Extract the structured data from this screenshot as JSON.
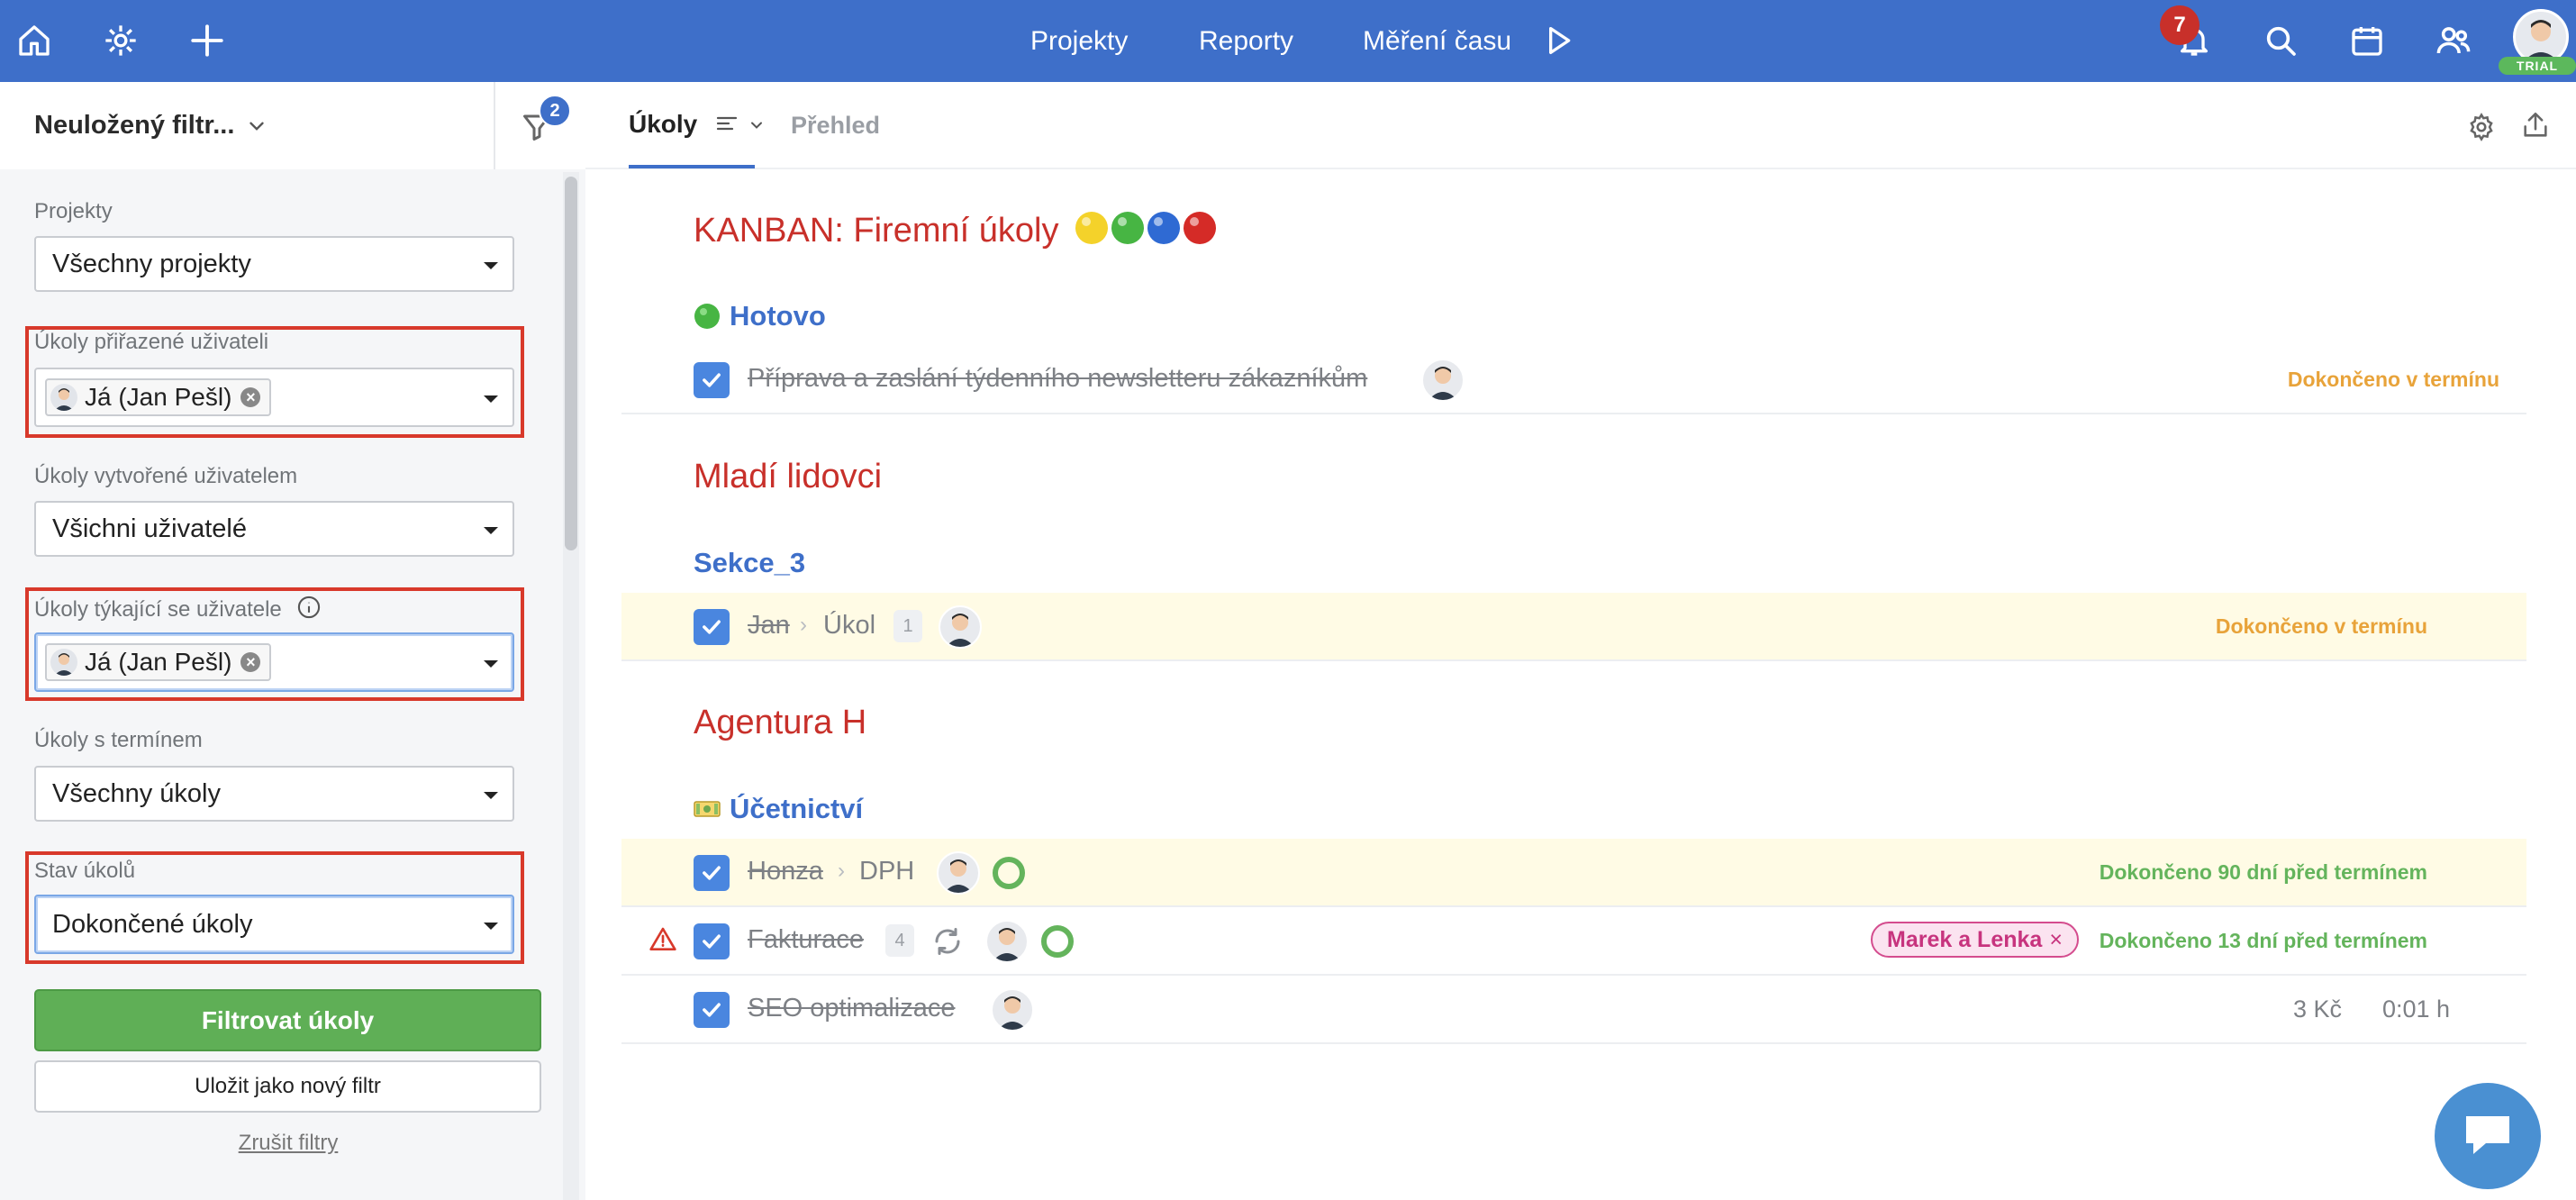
{
  "topbar": {
    "nav": [
      "Projekty",
      "Reporty",
      "Měření času"
    ],
    "notifications_count": "7",
    "trial_label": "TRIAL",
    "icons": [
      "home-icon",
      "settings-icon",
      "plus-icon",
      "play-icon",
      "bell-icon",
      "search-icon",
      "calendar-icon",
      "users-icon"
    ]
  },
  "sidebar": {
    "filter_name": "Neuložený filtr...",
    "active_filters_count": "2",
    "fields": [
      {
        "label": "Projekty",
        "value": "Všechny projekty"
      },
      {
        "label": "Úkoly přiřazené uživateli",
        "chip": "Já (Jan Pešl)"
      },
      {
        "label": "Úkoly vytvořené uživatelem",
        "value": "Všichni uživatelé"
      },
      {
        "label": "Úkoly týkající se uživatele",
        "chip": "Já (Jan Pešl)"
      },
      {
        "label": "Úkoly s termínem",
        "value": "Všechny úkoly"
      },
      {
        "label": "Stav úkolů",
        "value": "Dokončené úkoly"
      }
    ],
    "filter_button": "Filtrovat úkoly",
    "save_button": "Uložit jako nový filtr",
    "reset_link": "Zrušit filtry"
  },
  "tabs": [
    {
      "label": "Úkoly",
      "active": true
    },
    {
      "label": "Přehled",
      "active": false
    }
  ],
  "projects": [
    {
      "title": "KANBAN: Firemní úkoly",
      "emoji_dots": [
        "#f4d22a",
        "#47b543",
        "#2f6ad3",
        "#d52b27"
      ],
      "section": {
        "emoji": "green-circle",
        "name": "Hotovo"
      },
      "tasks": [
        {
          "text": "Příprava a zaslání týdenního newsletteru zákazníkům",
          "status": "Dokončeno v termínu",
          "status_color": "orange"
        }
      ]
    },
    {
      "title": "Mladí lidovci",
      "section": {
        "name": "Sekce_3"
      },
      "tasks": [
        {
          "parent": "Jan",
          "text": "Úkol",
          "count": "1",
          "status": "Dokončeno v termínu",
          "status_color": "orange"
        }
      ]
    },
    {
      "title": "Agentura H",
      "section": {
        "emoji": "money-icon",
        "name": "Účetnictví"
      },
      "tasks": [
        {
          "parent": "Honza",
          "text": "DPH",
          "status": "Dokončeno 90 dní před termínem",
          "status_color": "green"
        },
        {
          "text": "Fakturace",
          "count": "4",
          "tag": "Marek a Lenka",
          "status": "Dokončeno 13 dní před termínem",
          "status_color": "green",
          "warning": true
        },
        {
          "text": "SEO optimalizace",
          "price": "3 Kč",
          "time": "0:01 h"
        }
      ]
    }
  ],
  "colors": {
    "topbar": "#3e6fc9",
    "project_title": "#c8302a",
    "section_title": "#3e6fc9",
    "status_orange": "#e8a33a",
    "status_green": "#64b45c",
    "highlight_box": "#d8392b"
  }
}
